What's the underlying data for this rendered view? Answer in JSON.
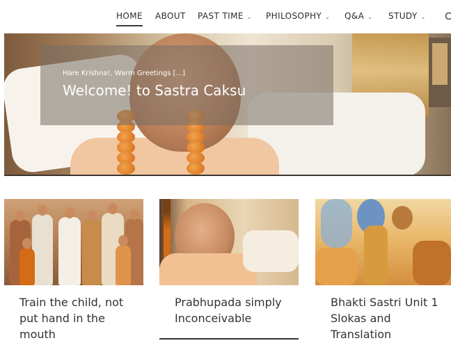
{
  "nav": {
    "items": [
      {
        "label": "HOME",
        "dropdown": false,
        "active": true
      },
      {
        "label": "ABOUT",
        "dropdown": false,
        "active": false
      },
      {
        "label": "PAST TIME",
        "dropdown": true,
        "active": false
      },
      {
        "label": "PHILOSOPHY",
        "dropdown": true,
        "active": false
      },
      {
        "label": "Q&A",
        "dropdown": true,
        "active": false
      },
      {
        "label": "STUDY",
        "dropdown": true,
        "active": false
      }
    ],
    "chevron_glyph": "⌄",
    "search_icon": "search-icon"
  },
  "hero": {
    "greeting": "Hare Krishna!, Warm Greetings [...]",
    "title": "Welcome! to Sastra Caksu"
  },
  "cards": [
    {
      "title": "Train the child, not put hand in the mouth"
    },
    {
      "title": "Prabhupada simply Inconceivable"
    },
    {
      "title": "Bhakti Sastri Unit 1 Slokas and Translation"
    }
  ],
  "colors": {
    "text": "#333333",
    "nav_text": "#2b2b2b",
    "caption_overlay": "rgba(120,110,100,0.55)",
    "saffron": "#d46b17"
  }
}
